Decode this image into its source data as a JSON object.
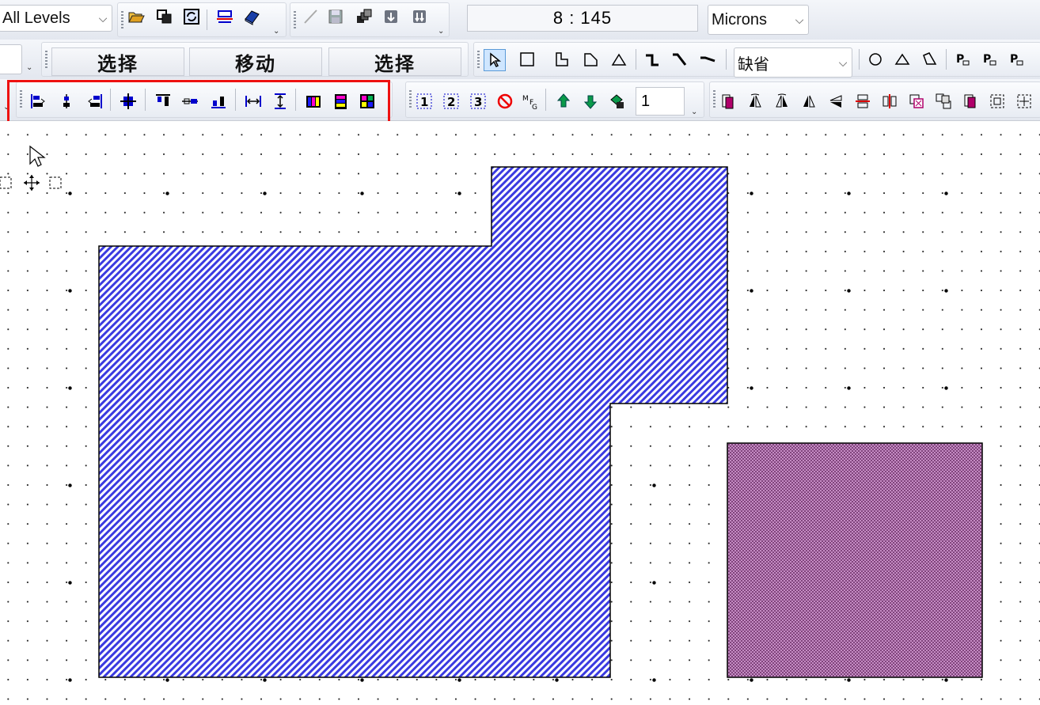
{
  "row1": {
    "levels_combo": "All Levels",
    "coordinate_readout": "8 : 145",
    "units_combo": "Microns"
  },
  "row2": {
    "select_label": "选择",
    "move_label": "移动",
    "select_label_2": "选择",
    "style_combo": "缺省"
  },
  "row3": {
    "layer_number": "1"
  },
  "colors": {
    "shape_blue_fill": "#3a3ae0",
    "shape_purple_fill": "#b56ab0",
    "highlight_red": "#ee1111",
    "icon_blue": "#0000cc",
    "icon_green": "#0a9a4a"
  }
}
